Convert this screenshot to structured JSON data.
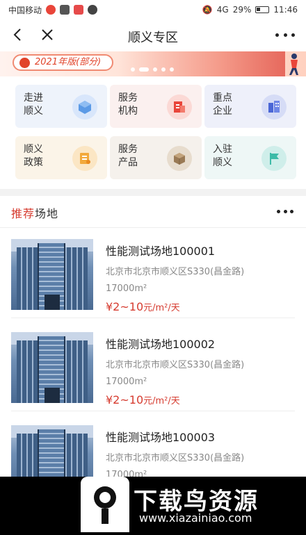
{
  "status_bar": {
    "carrier": "中国移动",
    "network": "4G",
    "battery": "29%",
    "time": "11:46"
  },
  "nav": {
    "title": "顺义专区",
    "icons": [
      "back-icon",
      "close-icon",
      "more-icon"
    ]
  },
  "banner": {
    "pill_text": "2021年版(部分)",
    "slide_count": 5,
    "active_slide": 2
  },
  "grid": {
    "items": [
      {
        "line1": "走进",
        "line2": "顺义",
        "icon": "cube-icon",
        "color": "#5b9ae6"
      },
      {
        "line1": "服务",
        "line2": "机构",
        "icon": "building-book-icon",
        "color": "#e9453a"
      },
      {
        "line1": "重点",
        "line2": "企业",
        "icon": "office-icon",
        "color": "#4a66d6"
      },
      {
        "line1": "顺义",
        "line2": "政策",
        "icon": "document-icon",
        "color": "#f2a93b"
      },
      {
        "line1": "服务",
        "line2": "产品",
        "icon": "box-icon",
        "color": "#9a7a55"
      },
      {
        "line1": "入驻",
        "line2": "顺义",
        "icon": "flag-icon",
        "color": "#3dbba8"
      }
    ]
  },
  "recommend": {
    "title_accent": "推荐",
    "title_rest": "场地",
    "listings": [
      {
        "title": "性能测试场地100001",
        "address": "北京市北京市顺义区S330(昌金路)",
        "area": "17000m²",
        "price": "¥2~10",
        "unit": "元/m²/天"
      },
      {
        "title": "性能测试场地100002",
        "address": "北京市北京市顺义区S330(昌金路)",
        "area": "17000m²",
        "price": "¥2~10",
        "unit": "元/m²/天"
      },
      {
        "title": "性能测试场地100003",
        "address": "北京市北京市顺义区S330(昌金路)",
        "area": "17000m²",
        "price": "",
        "unit": ""
      }
    ]
  },
  "watermark": {
    "name": "下载鸟资源",
    "url": "www.xiazainiao.com"
  },
  "colors": {
    "accent": "#d63b2f"
  }
}
